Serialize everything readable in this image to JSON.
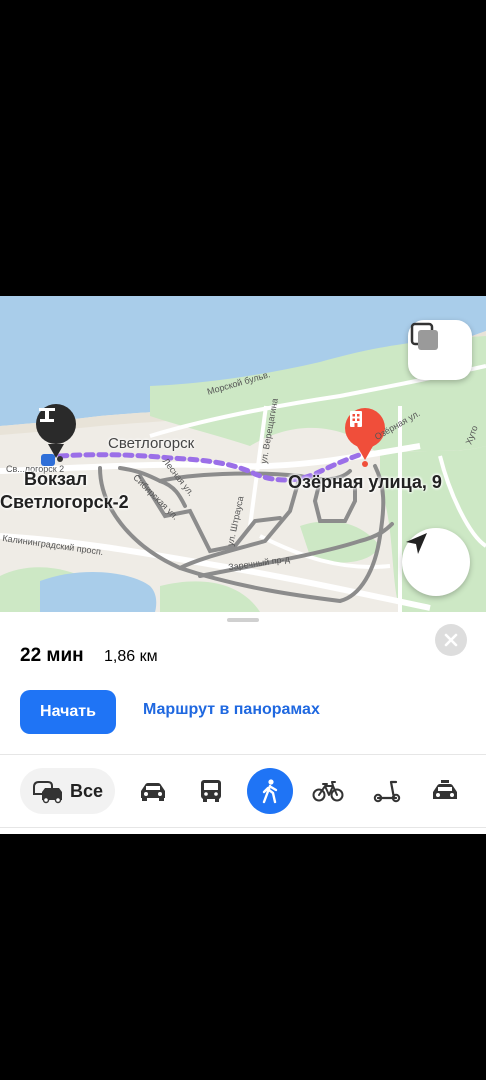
{
  "map": {
    "labels": {
      "city": "Светлогорск",
      "origin_line1": "Вокзал",
      "origin_line2": "Светлогорск-2",
      "destination": "Озёрная улица, 9",
      "street_morskoy": "Морской бульв.",
      "street_kaliningrad": "Калининградский просп.",
      "street_zarechny": "Заречный пр-д",
      "street_vereshagina": "ул. Верещагина",
      "street_shtrausa": "ул. Штрауса",
      "street_ozernaya_small": "Озёрная ул.",
      "street_sibirskaya": "Сибирская ул.",
      "street_lesnaya": "Лесная ул.",
      "street_hut": "Хуто",
      "station_tag": "Св...логорск 2"
    },
    "layers_button_icon": "layers-icon",
    "locate_button_icon": "navigation-arrow-icon",
    "colors": {
      "route_walk": "#9b6fe8",
      "route_alt": "#8c8c8c",
      "water": "#a9cdea",
      "greenery": "#cde8c5",
      "destination_pin": "#f04e3a",
      "origin_pin": "#2a2a2a"
    }
  },
  "route": {
    "duration": "22 мин",
    "distance": "1,86 км",
    "close_icon": "close-icon"
  },
  "actions": {
    "start_label": "Начать",
    "panorama_label": "Маршрут в панорамах"
  },
  "transport_modes": {
    "all_label": "Все",
    "items": [
      "car-icon",
      "bus-icon",
      "walk-icon",
      "bicycle-icon",
      "scooter-icon",
      "taxi-icon"
    ],
    "selected": "walk-icon",
    "accent": "#1f74f5"
  }
}
